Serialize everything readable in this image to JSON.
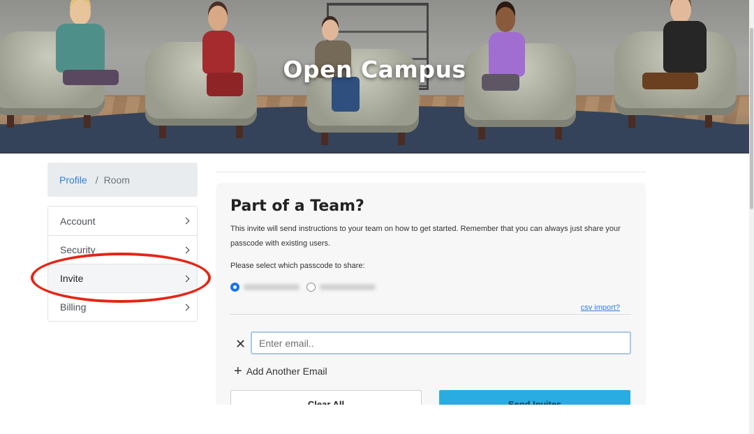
{
  "hero": {
    "title": "Open Campus"
  },
  "breadcrumb": {
    "link": "Profile",
    "separator": "/",
    "current": "Room"
  },
  "sidebar": {
    "items": [
      {
        "label": "Account"
      },
      {
        "label": "Security"
      },
      {
        "label": "Invite"
      },
      {
        "label": "Billing"
      }
    ],
    "active_index": 2
  },
  "invite": {
    "heading": "Part of a Team?",
    "description": "This invite will send instructions to your team on how to get started. Remember that you can always just share your passcode with existing users.",
    "select_label": "Please select which passcode to share:",
    "csv_link": "csv import?",
    "email_placeholder": "Enter email..",
    "add_email_label": "Add Another Email",
    "clear_button": "Clear All",
    "send_button": "Send Invites"
  },
  "colors": {
    "accent_link": "#2f7ed8",
    "send_button_bg": "#29ace1",
    "annotation_circle": "#e42616"
  },
  "icons": {
    "menu_chevron": "chevron-right-icon",
    "remove": "close-icon",
    "add": "plus-icon"
  }
}
